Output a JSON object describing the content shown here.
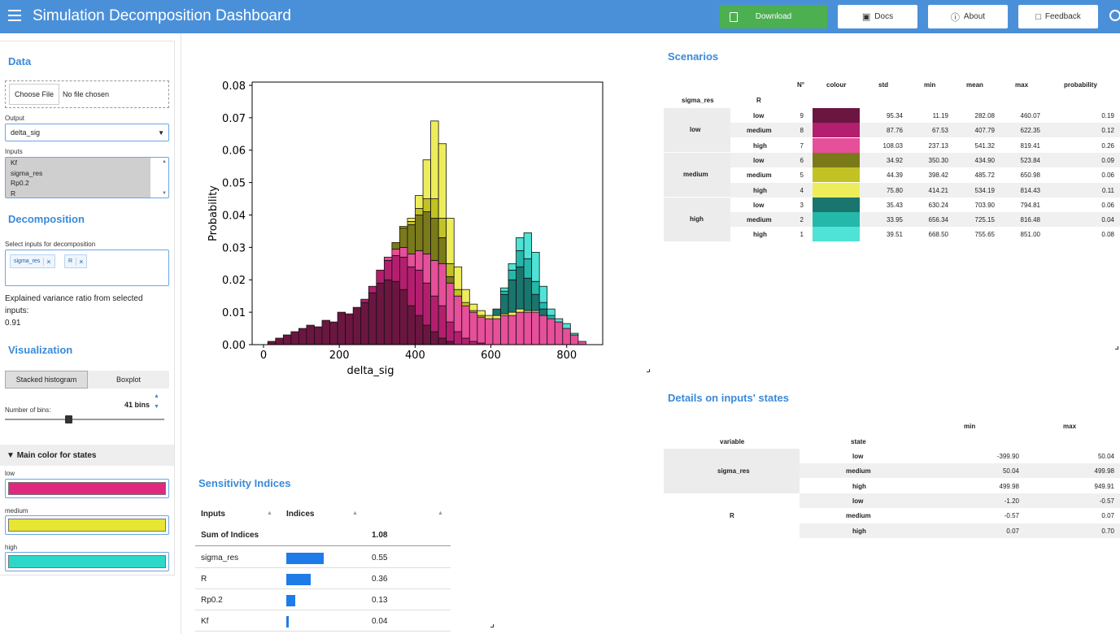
{
  "header": {
    "title": "Simulation Decomposition Dashboard",
    "download": "Download",
    "docs": "Docs",
    "about": "About",
    "feedback": "Feedback"
  },
  "sidebar": {
    "data_title": "Data",
    "choose_file": "Choose File",
    "no_file": "No file chosen",
    "output_label": "Output",
    "output_value": "delta_sig",
    "inputs_label": "Inputs",
    "inputs_options": [
      "Kf",
      "sigma_res",
      "Rp0.2",
      "R"
    ],
    "decomp_title": "Decomposition",
    "select_inputs_label": "Select inputs for decomposition",
    "chips": [
      "sigma_res",
      "R"
    ],
    "explained_text": "Explained variance ratio from selected inputs:",
    "explained_value": "0.91",
    "viz_title": "Visualization",
    "tab_stacked": "Stacked histogram",
    "tab_boxplot": "Boxplot",
    "bins_label": "Number of bins:",
    "bins_value": "41 bins",
    "bins_count": 41,
    "color_section": "Main color for states",
    "color_states": [
      {
        "label": "low",
        "color": "#e0287f"
      },
      {
        "label": "medium",
        "color": "#e6e633"
      },
      {
        "label": "high",
        "color": "#2ed8c8"
      }
    ]
  },
  "sensitivity": {
    "title": "Sensitivity Indices",
    "col_inputs": "Inputs",
    "col_indices": "Indices",
    "sum_label": "Sum of Indices",
    "sum_value": "1.08",
    "rows": [
      {
        "name": "sigma_res",
        "value": "0.55",
        "v": 0.55
      },
      {
        "name": "R",
        "value": "0.36",
        "v": 0.36
      },
      {
        "name": "Rp0.2",
        "value": "0.13",
        "v": 0.13
      },
      {
        "name": "Kf",
        "value": "0.04",
        "v": 0.04
      }
    ]
  },
  "scenarios": {
    "title": "Scenarios",
    "headers": [
      "N°",
      "colour",
      "std",
      "min",
      "mean",
      "max",
      "probability"
    ],
    "row_headers": [
      "sigma_res",
      "R"
    ],
    "groups": [
      "low",
      "medium",
      "high"
    ],
    "rows": [
      {
        "R": "low",
        "n": "9",
        "color": "#6b1640",
        "std": "95.34",
        "min": "11.19",
        "mean": "282.08",
        "max": "460.07",
        "prob": "0.19"
      },
      {
        "R": "medium",
        "n": "8",
        "color": "#b31f6e",
        "std": "87.76",
        "min": "67.53",
        "mean": "407.79",
        "max": "622.35",
        "prob": "0.12"
      },
      {
        "R": "high",
        "n": "7",
        "color": "#e64f99",
        "std": "108.03",
        "min": "237.13",
        "mean": "541.32",
        "max": "819.41",
        "prob": "0.26"
      },
      {
        "R": "low",
        "n": "6",
        "color": "#7a7a1a",
        "std": "34.92",
        "min": "350.30",
        "mean": "434.90",
        "max": "523.84",
        "prob": "0.09"
      },
      {
        "R": "medium",
        "n": "5",
        "color": "#c2c224",
        "std": "44.39",
        "min": "398.42",
        "mean": "485.72",
        "max": "650.98",
        "prob": "0.06"
      },
      {
        "R": "high",
        "n": "4",
        "color": "#eded5c",
        "std": "75.80",
        "min": "414.21",
        "mean": "534.19",
        "max": "814.43",
        "prob": "0.11"
      },
      {
        "R": "low",
        "n": "3",
        "color": "#1a756e",
        "std": "35.43",
        "min": "630.24",
        "mean": "703.90",
        "max": "794.81",
        "prob": "0.06"
      },
      {
        "R": "medium",
        "n": "2",
        "color": "#24b8aa",
        "std": "33.95",
        "min": "656.34",
        "mean": "725.15",
        "max": "816.48",
        "prob": "0.04"
      },
      {
        "R": "high",
        "n": "1",
        "color": "#4ee3d6",
        "std": "39.51",
        "min": "668.50",
        "mean": "755.65",
        "max": "851.00",
        "prob": "0.08"
      }
    ]
  },
  "details": {
    "title": "Details on inputs' states",
    "headers": [
      "min",
      "max"
    ],
    "row_headers": [
      "variable",
      "state"
    ],
    "vars": [
      "sigma_res",
      "R"
    ],
    "rows": [
      {
        "state": "low",
        "min": "-399.90",
        "max": "50.04"
      },
      {
        "state": "medium",
        "min": "50.04",
        "max": "499.98"
      },
      {
        "state": "high",
        "min": "499.98",
        "max": "949.91"
      },
      {
        "state": "low",
        "min": "-1.20",
        "max": "-0.57"
      },
      {
        "state": "medium",
        "min": "-0.57",
        "max": "0.07"
      },
      {
        "state": "high",
        "min": "0.07",
        "max": "0.70"
      }
    ]
  },
  "chart_data": {
    "type": "bar",
    "stacked": true,
    "xlabel": "delta_sig",
    "ylabel": "Probability",
    "xlim": [
      -30,
      895
    ],
    "ylim": [
      0,
      0.081
    ],
    "xticks": [
      "0",
      "200",
      "400",
      "600",
      "800"
    ],
    "yticks": [
      "0.00",
      "0.01",
      "0.02",
      "0.03",
      "0.04",
      "0.05",
      "0.06",
      "0.07",
      "0.08"
    ],
    "bin_start": 11.19,
    "bin_width": 20.48,
    "series": [
      {
        "name": "low/low",
        "color": "#6b1640",
        "values": [
          0.001,
          0.002,
          0.003,
          0.004,
          0.005,
          0.006,
          0.0055,
          0.0075,
          0.007,
          0.01,
          0.0095,
          0.0115,
          0.013,
          0.016,
          0.019,
          0.02,
          0.0195,
          0.017,
          0.012,
          0.009,
          0.006,
          0.004,
          0.002,
          0.001,
          0,
          0,
          0,
          0,
          0,
          0,
          0,
          0,
          0,
          0,
          0,
          0,
          0,
          0,
          0,
          0,
          0
        ]
      },
      {
        "name": "low/medium",
        "color": "#b31f6e",
        "values": [
          0,
          0,
          0,
          0,
          0,
          0,
          0,
          0,
          0,
          0,
          0,
          0,
          0.001,
          0.002,
          0.004,
          0.006,
          0.008,
          0.01,
          0.012,
          0.014,
          0.013,
          0.011,
          0.01,
          0.006,
          0.004,
          0.002,
          0.001,
          0.0005,
          0,
          0,
          0,
          0,
          0,
          0,
          0,
          0,
          0,
          0,
          0,
          0,
          0
        ]
      },
      {
        "name": "low/high",
        "color": "#e64f99",
        "values": [
          0,
          0,
          0,
          0,
          0,
          0,
          0,
          0,
          0,
          0,
          0,
          0,
          0,
          0,
          0,
          0.001,
          0.002,
          0.003,
          0.004,
          0.006,
          0.009,
          0.011,
          0.013,
          0.012,
          0.011,
          0.01,
          0.009,
          0.008,
          0.008,
          0.008,
          0.009,
          0.009,
          0.01,
          0.01,
          0.01,
          0.009,
          0.008,
          0.007,
          0.005,
          0.003,
          0.001
        ]
      },
      {
        "name": "medium/low",
        "color": "#7a7a1a",
        "values": [
          0,
          0,
          0,
          0,
          0,
          0,
          0,
          0,
          0,
          0,
          0,
          0,
          0,
          0,
          0,
          0,
          0.002,
          0.006,
          0.009,
          0.011,
          0.013,
          0.013,
          0.008,
          0.002,
          0,
          0,
          0,
          0,
          0,
          0,
          0,
          0,
          0,
          0,
          0,
          0,
          0,
          0,
          0,
          0,
          0
        ]
      },
      {
        "name": "medium/medium",
        "color": "#c2c224",
        "values": [
          0,
          0,
          0,
          0,
          0,
          0,
          0,
          0,
          0,
          0,
          0,
          0,
          0,
          0,
          0,
          0,
          0,
          0.0005,
          0.001,
          0.002,
          0.004,
          0.006,
          0.006,
          0.004,
          0.002,
          0.001,
          0.0005,
          0.0005,
          0,
          0,
          0,
          0,
          0,
          0,
          0,
          0,
          0,
          0,
          0,
          0,
          0
        ]
      },
      {
        "name": "medium/high",
        "color": "#eded5c",
        "values": [
          0,
          0,
          0,
          0,
          0,
          0,
          0,
          0,
          0,
          0,
          0,
          0,
          0,
          0,
          0,
          0,
          0,
          0,
          0.001,
          0.004,
          0.012,
          0.024,
          0.023,
          0.014,
          0.007,
          0.004,
          0.002,
          0.0015,
          0.001,
          0.001,
          0.0005,
          0.001,
          0.001,
          0.0005,
          0.0005,
          0,
          0,
          0,
          0,
          0,
          0
        ]
      },
      {
        "name": "high/low",
        "color": "#1a756e",
        "values": [
          0,
          0,
          0,
          0,
          0,
          0,
          0,
          0,
          0,
          0,
          0,
          0,
          0,
          0,
          0,
          0,
          0,
          0,
          0,
          0,
          0,
          0,
          0,
          0,
          0,
          0,
          0,
          0,
          0,
          0.002,
          0.006,
          0.01,
          0.013,
          0.01,
          0.005,
          0.002,
          0,
          0,
          0,
          0,
          0
        ]
      },
      {
        "name": "high/medium",
        "color": "#24b8aa",
        "values": [
          0,
          0,
          0,
          0,
          0,
          0,
          0,
          0,
          0,
          0,
          0,
          0,
          0,
          0,
          0,
          0,
          0,
          0,
          0,
          0,
          0,
          0,
          0,
          0,
          0,
          0,
          0,
          0,
          0,
          0,
          0.001,
          0.003,
          0.005,
          0.006,
          0.004,
          0.002,
          0.001,
          0,
          0,
          0,
          0
        ]
      },
      {
        "name": "high/high",
        "color": "#4ee3d6",
        "values": [
          0,
          0,
          0,
          0,
          0,
          0,
          0,
          0,
          0,
          0,
          0,
          0,
          0,
          0,
          0,
          0,
          0,
          0,
          0,
          0,
          0,
          0,
          0,
          0,
          0,
          0,
          0,
          0,
          0,
          0,
          0.001,
          0.002,
          0.004,
          0.008,
          0.009,
          0.005,
          0.002,
          0.001,
          0.0015,
          0.0005,
          0
        ]
      }
    ]
  }
}
